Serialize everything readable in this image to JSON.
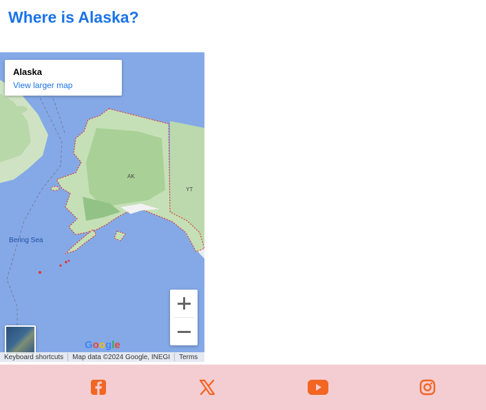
{
  "page": {
    "title": "Where is Alaska?"
  },
  "map": {
    "place_title": "Alaska",
    "view_larger_label": "View larger map",
    "labels": {
      "bering_sea": "Bering Sea",
      "ak": "AK",
      "yt": "YT"
    },
    "zoom_in_icon": "plus-icon",
    "zoom_out_icon": "minus-icon",
    "logo_text": "Google",
    "attribution": {
      "keyboard_shortcuts": "Keyboard shortcuts",
      "map_data": "Map data ©2024 Google, INEGI",
      "terms": "Terms"
    }
  },
  "footer": {
    "icons": [
      "facebook-icon",
      "x-icon",
      "youtube-icon",
      "instagram-icon"
    ],
    "accent_color": "#f26522",
    "background_color": "#f4cdd2"
  }
}
